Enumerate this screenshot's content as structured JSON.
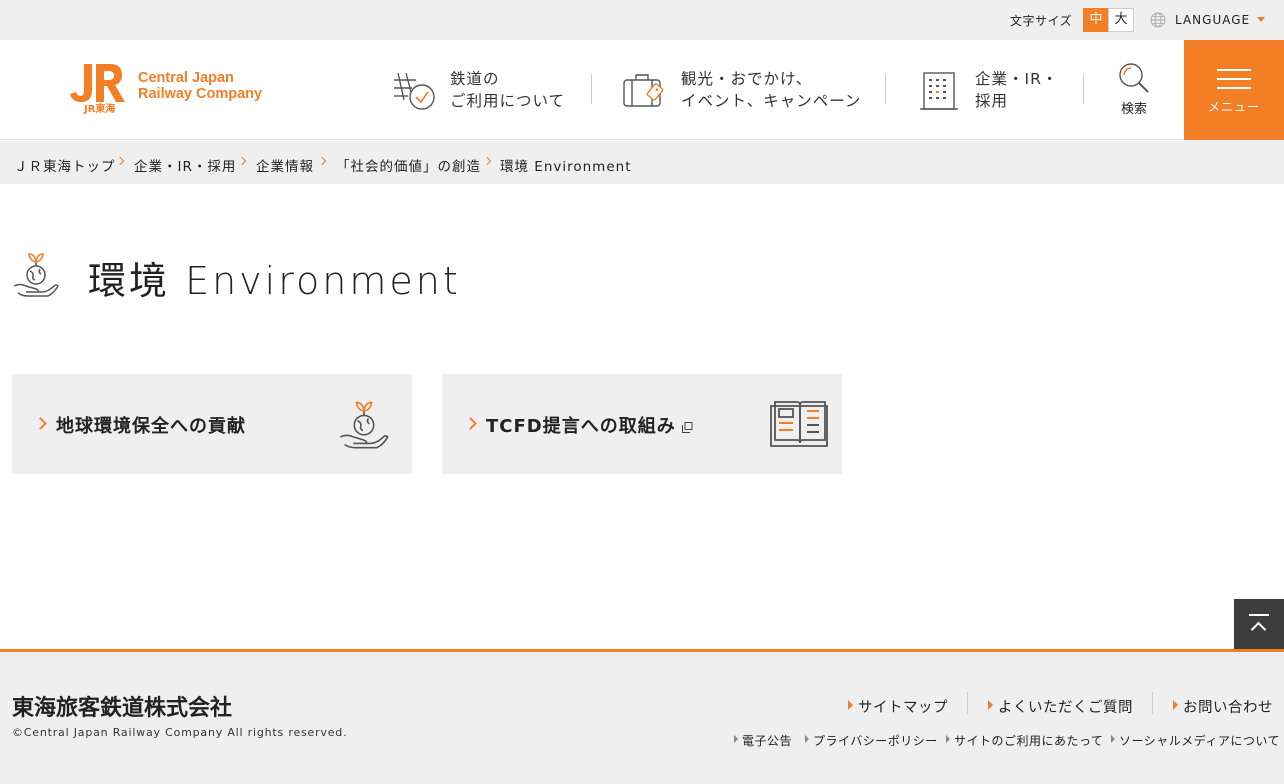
{
  "colors": {
    "accent": "#f27e26",
    "panel": "#efefef",
    "text": "#222222"
  },
  "utility": {
    "fontsize_label": "文字サイズ",
    "size_medium": "中",
    "size_large": "大",
    "language_label": "LANGUAGE"
  },
  "header": {
    "logo": {
      "mark": "JR東海",
      "text": "Central Japan\nRailway Company"
    },
    "nav": [
      {
        "label": "鉄道の\nご利用について",
        "icon": "train-clock-icon"
      },
      {
        "label": "観光・おでかけ、\nイベント、キャンペーン",
        "icon": "suitcase-icon"
      },
      {
        "label": "企業・IR・\n採用",
        "icon": "building-icon"
      }
    ],
    "search_label": "検索",
    "menu_label": "メニュー"
  },
  "breadcrumb": [
    "ＪＲ東海トップ",
    "企業・IR・採用",
    "企業情報",
    "「社会的価値」の創造",
    "環境 Environment"
  ],
  "page": {
    "title": "環境 Environment",
    "title_icon": "hand-globe-sprout-icon"
  },
  "cards": [
    {
      "label": "地球環境保全への貢献",
      "icon": "hand-globe-sprout-icon",
      "external": false
    },
    {
      "label": "TCFD提言への取組み",
      "icon": "open-book-icon",
      "external": true
    }
  ],
  "footer": {
    "company": "東海旅客鉄道株式会社",
    "copyright": "©Central Japan Railway Company All rights reserved.",
    "main_links": [
      "サイトマップ",
      "よくいただくご質問",
      "お問い合わせ"
    ],
    "sub_links": [
      "電子公告",
      "プライバシーポリシー",
      "サイトのご利用にあたって",
      "ソーシャルメディアについて"
    ]
  }
}
